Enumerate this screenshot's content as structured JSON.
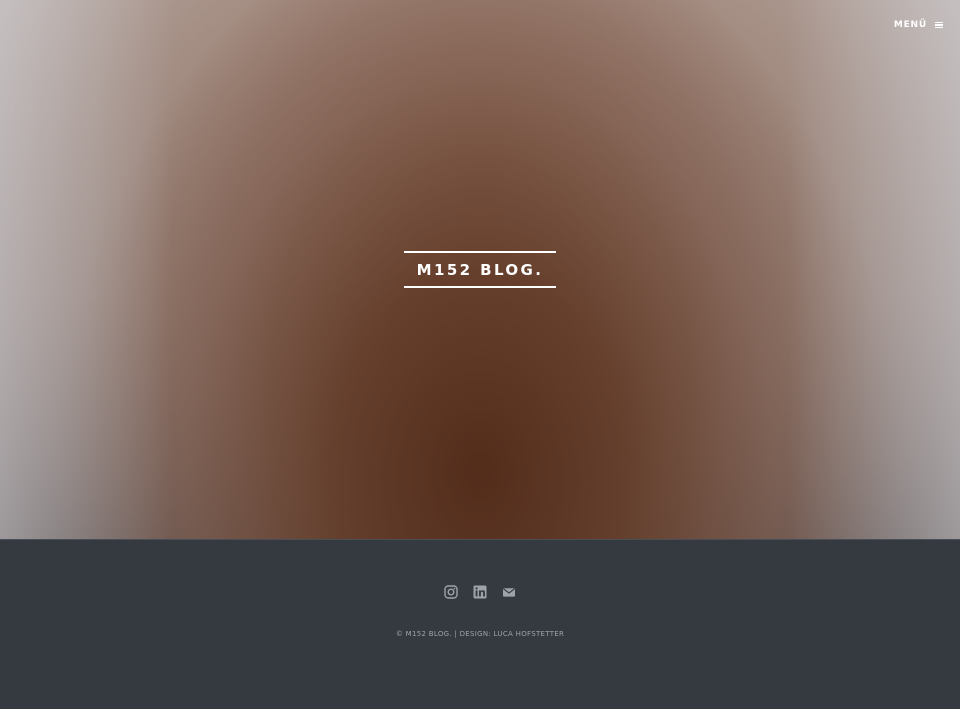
{
  "header": {
    "menu_label": "MENÜ",
    "menu_icon": "hamburger-icon"
  },
  "hero": {
    "site_title": "M152 BLOG."
  },
  "footer": {
    "social": [
      {
        "icon": "instagram-icon"
      },
      {
        "icon": "linkedin-icon"
      },
      {
        "icon": "envelope-icon"
      }
    ],
    "copyright": "© M152 BLOG. | DESIGN: LUCA HOFSTETTER"
  },
  "colors": {
    "footer_bg": "#353940",
    "footer_text": "#9ea3aa",
    "hero_text": "#ffffff"
  }
}
